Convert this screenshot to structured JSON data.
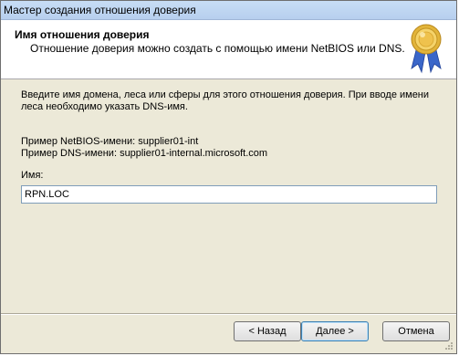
{
  "window": {
    "title": "Мастер создания отношения доверия"
  },
  "header": {
    "heading": "Имя отношения доверия",
    "subheading": "Отношение доверия можно создать с помощью имени NetBIOS или DNS.",
    "icon": "certificate-seal-icon"
  },
  "content": {
    "intro": "Введите имя домена, леса или сферы для этого отношения доверия. При вводе имени леса необходимо указать DNS-имя.",
    "example_netbios": "Пример NetBIOS-имени: supplier01-int",
    "example_dns": "Пример DNS-имени: supplier01-internal.microsoft.com",
    "name_label": "Имя:",
    "name_value": "RPN.LOC"
  },
  "buttons": {
    "back": "< Назад",
    "next": "Далее >",
    "cancel": "Отмена"
  },
  "colors": {
    "titlebar": "#c7ddf5",
    "dialog_bg": "#ece9d8",
    "header_bg": "#ffffff",
    "seal_gold": "#e2b43a",
    "ribbon_blue": "#3a66c9"
  }
}
